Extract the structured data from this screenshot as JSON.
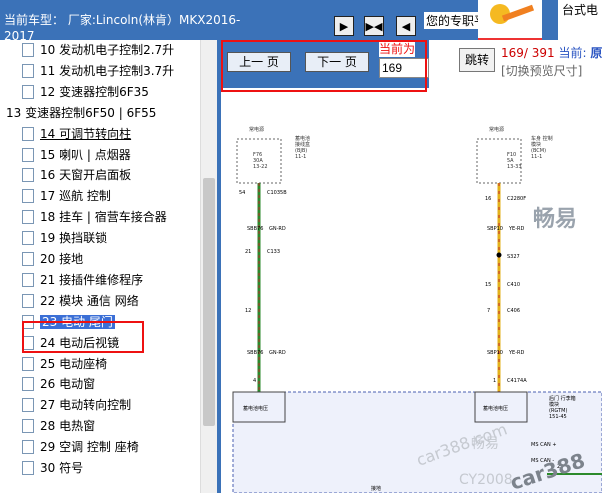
{
  "header": {
    "car_model": "当前车型： 厂家:Lincoln(林肯）MKX2016-2017",
    "promo_text": "您的专职平台",
    "brand_text": "台式电"
  },
  "tree": {
    "items": [
      {
        "label": "10 发动机电子控制2.7升"
      },
      {
        "label": "11 发动机电子控制3.7升"
      },
      {
        "label": "12 变速器控制6F35"
      },
      {
        "label": "13 变速器控制6F50 | 6F55"
      },
      {
        "label": "14 可调节转向柱"
      },
      {
        "label": "15 喇叭 | 点烟器"
      },
      {
        "label": "16 天窗开启面板"
      },
      {
        "label": "17 巡航 控制"
      },
      {
        "label": "18 挂车 | 宿营车接合器"
      },
      {
        "label": "19 换挡联锁"
      },
      {
        "label": "20 接地"
      },
      {
        "label": "21 接插件维修程序"
      },
      {
        "label": "22 模块 通信 网络"
      },
      {
        "label": "23 电动 尾门"
      },
      {
        "label": "24 电动后视镜"
      },
      {
        "label": "25 电动座椅"
      },
      {
        "label": "26 电动窗"
      },
      {
        "label": "27 电动转向控制"
      },
      {
        "label": "28 电热窗"
      },
      {
        "label": "29 空调 控制 座椅"
      },
      {
        "label": "30 符号"
      }
    ]
  },
  "pager": {
    "prev_label": "上一 页",
    "next_label": "下一 页",
    "current_label": "当前为",
    "page_value": "169",
    "jump_label": "跳转",
    "count_text": "169/ 391",
    "current_word": "当前:",
    "current_name": "原始",
    "preview_text": "[切换预览尺寸]"
  },
  "diagram": {
    "labels": {
      "pwr_left": "常电源",
      "fuse_left": "F76\n30A\n13-22",
      "bjb": "蓄电池\n接线盒\n(BJB)\n11-1",
      "pwr_right": "常电源",
      "fuse_right": "F10\n5A\n13-33",
      "bcm": "车身 控制\n模块\n(BCM)\n11-1",
      "c1035b": "C1035B",
      "c2280f": "C2280F",
      "c133": "C133",
      "s327": "S327",
      "c410": "C410",
      "c406": "C406",
      "c4174a": "C4174A",
      "sbb76": "SBB76",
      "sbp10": "SBP10",
      "gn_rd": "GN-RD",
      "ye_rd": "YE-RD",
      "pin54": "54",
      "pin16": "16",
      "pin21": "21",
      "pin22": "22",
      "pin15": "15",
      "pin12": "12",
      "pin7": "7",
      "pin4": "4",
      "pin1": "1",
      "batt_left": "蓄电池电压",
      "batt_right": "蓄电池电压",
      "rgtm": "后门 行李箱\n模块\n(RGTM)\n151-45",
      "ms_can_p": "MS CAN +",
      "ms_can_n": "MS CAN -",
      "pin23": "23",
      "ground": "接地",
      "wm1": "畅易",
      "wm2": "畅易",
      "wm3": "car388.com",
      "wm4": "CY2008",
      "wm5": "car388"
    }
  }
}
